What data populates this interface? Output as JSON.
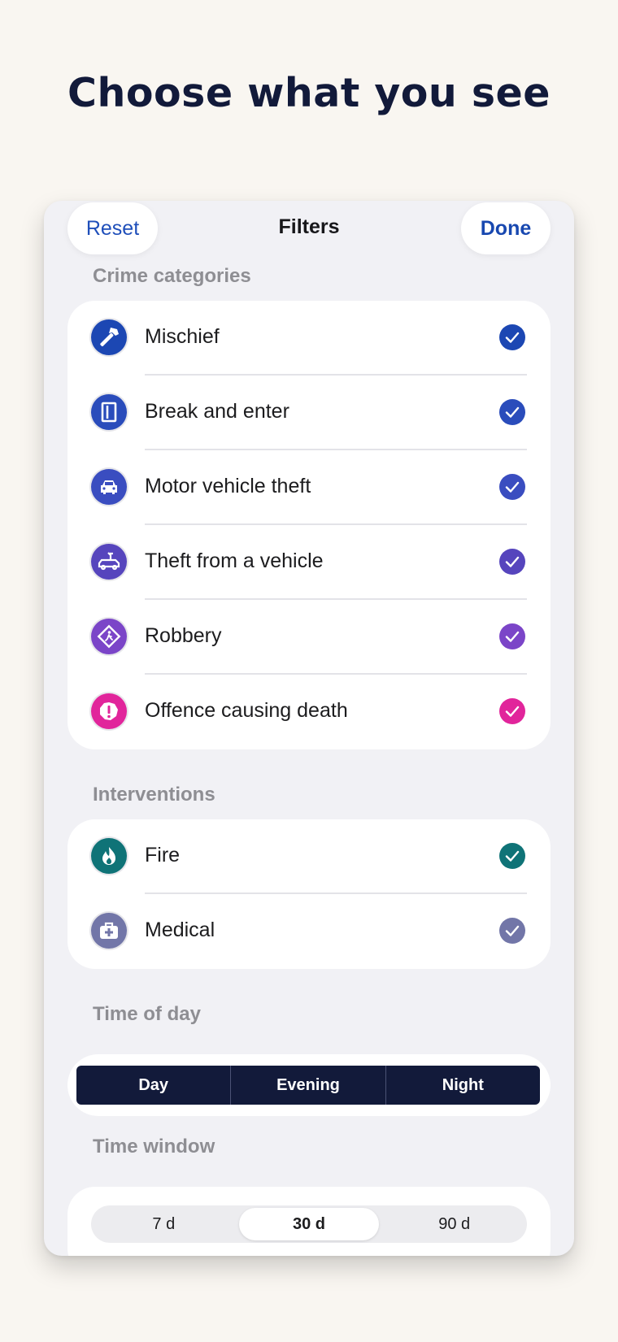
{
  "headline": "Choose what you see",
  "header": {
    "reset_label": "Reset",
    "title": "Filters",
    "done_label": "Done"
  },
  "sections": {
    "crime_label": "Crime categories",
    "interventions_label": "Interventions",
    "time_of_day_label": "Time of day",
    "time_window_label": "Time window"
  },
  "crime_categories": [
    {
      "label": "Mischief",
      "icon": "hammer-icon",
      "color": "#1c47b3",
      "checked": true
    },
    {
      "label": "Break and enter",
      "icon": "door-icon",
      "color": "#2a4cbb",
      "checked": true
    },
    {
      "label": "Motor vehicle theft",
      "icon": "car-icon",
      "color": "#3a4dc0",
      "checked": true
    },
    {
      "label": "Theft from a vehicle",
      "icon": "car-arm-icon",
      "color": "#5645bd",
      "checked": true
    },
    {
      "label": "Robbery",
      "icon": "person-diamond-icon",
      "color": "#7b45c8",
      "checked": true
    },
    {
      "label": "Offence causing death",
      "icon": "alert-icon",
      "color": "#e1259b",
      "checked": true
    }
  ],
  "interventions": [
    {
      "label": "Fire",
      "icon": "flame-icon",
      "color": "#0f7377",
      "checked": true
    },
    {
      "label": "Medical",
      "icon": "medical-kit-icon",
      "color": "#7276a8",
      "checked": true
    }
  ],
  "time_of_day": {
    "options": [
      "Day",
      "Evening",
      "Night"
    ],
    "background": "#121a3a"
  },
  "time_window": {
    "options": [
      "7 d",
      "30 d",
      "90 d"
    ],
    "selected": "30 d"
  }
}
